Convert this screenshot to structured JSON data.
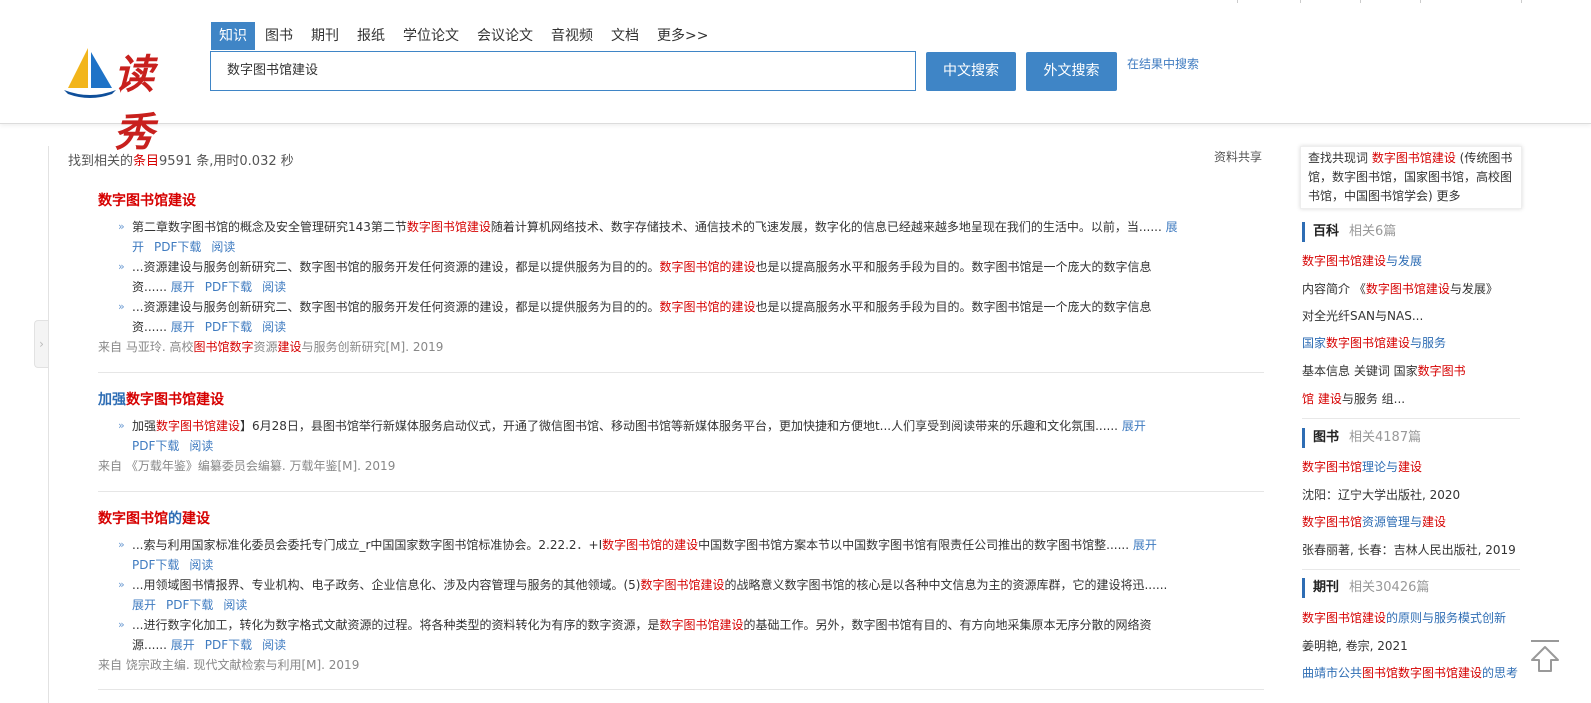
{
  "brand": {
    "logo_text": "读秀"
  },
  "tabs": [
    {
      "label": "知识",
      "active": true
    },
    {
      "label": "图书"
    },
    {
      "label": "期刊"
    },
    {
      "label": "报纸"
    },
    {
      "label": "学位论文"
    },
    {
      "label": "会议论文"
    },
    {
      "label": "音视频"
    },
    {
      "label": "文档"
    },
    {
      "label": "更多>>"
    }
  ],
  "search": {
    "value": "数字图书馆建设",
    "cn_button": "中文搜索",
    "foreign_button": "外文搜索",
    "in_result": "在结果中搜索"
  },
  "summary": {
    "prefix": "找到相关的",
    "entries_word": "条目",
    "count": "9591",
    "suffix": " 条,用时0.032 秒",
    "share": "资料共享"
  },
  "results": [
    {
      "title_parts": [
        {
          "t": "数字图书馆建设",
          "c": "red"
        }
      ],
      "snippets": [
        {
          "parts": [
            {
              "t": "第二章数字图书馆的概念及安全管理研究143第二节"
            },
            {
              "t": "数字图书馆建设",
              "hl": true
            },
            {
              "t": "随着计算机网络技术、数字存储技术、通信技术的飞速发展，数字化的信息已经越来越多地呈现在我们的生活中。以前，当......"
            }
          ],
          "actions": [
            "展开",
            "PDF下载",
            "阅读"
          ]
        },
        {
          "parts": [
            {
              "t": "...资源建设与服务创新研究二、数字图书馆的服务开发任何资源的建设，都是以提供服务为目的的。"
            },
            {
              "t": "数字图书馆的建设",
              "hl": true
            },
            {
              "t": "也是以提高服务水平和服务手段为目的。数字图书馆是一个庞大的数字信息资......"
            }
          ],
          "actions": [
            "展开",
            "PDF下载",
            "阅读"
          ]
        },
        {
          "parts": [
            {
              "t": "...资源建设与服务创新研究二、数字图书馆的服务开发任何资源的建设，都是以提供服务为目的的。"
            },
            {
              "t": "数字图书馆的建设",
              "hl": true
            },
            {
              "t": "也是以提高服务水平和服务手段为目的。数字图书馆是一个庞大的数字信息资......"
            }
          ],
          "actions": [
            "展开",
            "PDF下载",
            "阅读"
          ]
        }
      ],
      "source_parts": [
        {
          "t": "来自 马亚玲. 高校"
        },
        {
          "t": "图书馆数字",
          "hl": true
        },
        {
          "t": "资源"
        },
        {
          "t": "建设",
          "hl": true
        },
        {
          "t": "与服务创新研究[M]. 2019"
        }
      ]
    },
    {
      "title_parts": [
        {
          "t": "加强",
          "c": "blue"
        },
        {
          "t": "数字图书馆建设",
          "c": "red"
        }
      ],
      "snippets": [
        {
          "parts": [
            {
              "t": "加强"
            },
            {
              "t": "数字图书馆建设",
              "hl": true
            },
            {
              "t": "】6月28日，县图书馆举行新媒体服务启动仪式，开通了微信图书馆、移动图书馆等新媒体服务平台，更加快捷和方便地t...人们享受到阅读带来的乐趣和文化氛围......"
            }
          ],
          "actions": [
            "展开",
            "PDF下载",
            "阅读"
          ]
        }
      ],
      "source_parts": [
        {
          "t": "来自 《万载年鉴》编纂委员会编纂. 万载年鉴[M]. 2019"
        }
      ]
    },
    {
      "title_parts": [
        {
          "t": "数字图书馆",
          "c": "red"
        },
        {
          "t": "的",
          "c": "blue"
        },
        {
          "t": "建设",
          "c": "red"
        }
      ],
      "snippets": [
        {
          "parts": [
            {
              "t": "...索与利用国家标准化委员会委托专门成立_r中国国家数字图书馆标准协会。2.22.2．+I"
            },
            {
              "t": "数字图书馆的建设",
              "hl": true
            },
            {
              "t": "中国数字图书馆方案本节以中国数字图书馆有限责任公司推出的数字图书馆整......"
            }
          ],
          "actions": [
            "展开",
            "PDF下载",
            "阅读"
          ]
        },
        {
          "parts": [
            {
              "t": "...用领域图书情报界、专业机构、电子政务、企业信息化、涉及内容管理与服务的其他领域。(5)"
            },
            {
              "t": "数字图书馆建设",
              "hl": true
            },
            {
              "t": "的战略意义数字图书馆的核心是以各种中文信息为主的资源库群，它的建设将迅......"
            }
          ],
          "actions": [
            "展开",
            "PDF下载",
            "阅读"
          ]
        },
        {
          "parts": [
            {
              "t": "...进行数字化加工，转化为数字格式文献资源的过程。将各种类型的资料转化为有序的数字资源，是"
            },
            {
              "t": "数字图书馆建设",
              "hl": true
            },
            {
              "t": "的基础工作。另外，数字图书馆有目的、有方向地采集原本无序分散的网络资源......"
            }
          ],
          "actions": [
            "展开",
            "PDF下载",
            "阅读"
          ]
        }
      ],
      "source_parts": [
        {
          "t": "来自 饶宗政主编. 现代文献检索与利用[M]. 2019"
        }
      ]
    }
  ],
  "sidebar": {
    "cooc": {
      "prefix": "查找共现词 ",
      "term": "数字图书馆建设",
      "rest": " (传统图书馆，数字图书馆，国家图书馆，高校图书馆，中国图书馆学会)  更多"
    },
    "baike": {
      "title": "百科",
      "count": "相关6篇",
      "line1": [
        {
          "t": "数字图书馆建设",
          "c": "red"
        },
        {
          "t": "与发展",
          "c": "blue"
        }
      ],
      "line2": [
        {
          "t": "内容简介          《"
        },
        {
          "t": "数字图书馆建设",
          "c": "red"
        },
        {
          "t": "与发展》"
        }
      ],
      "line3": [
        {
          "t": "对全光纤SAN与NAS..."
        }
      ],
      "line4": [
        {
          "t": "国家",
          "c": "blue"
        },
        {
          "t": "数字图书馆建设",
          "c": "red"
        },
        {
          "t": "与服务",
          "c": "blue"
        }
      ],
      "line5": [
        {
          "t": "基本信息        关键词        国家"
        },
        {
          "t": "数字图书",
          "c": "red"
        }
      ],
      "line6": [
        {
          "t": "馆 建设",
          "c": "red"
        },
        {
          "t": "与服务        组..."
        }
      ]
    },
    "books": {
      "title": "图书",
      "count": "相关4187篇",
      "items": [
        {
          "title_parts": [
            {
              "t": "数字图书馆",
              "c": "red"
            },
            {
              "t": "理论与",
              "c": "blue"
            },
            {
              "t": "建设",
              "c": "red"
            }
          ],
          "meta": "沈阳：辽宁大学出版社, 2020"
        },
        {
          "title_parts": [
            {
              "t": "数字图书馆",
              "c": "red"
            },
            {
              "t": "资源管理与",
              "c": "blue"
            },
            {
              "t": "建设",
              "c": "red"
            }
          ],
          "meta": "张春丽著, 长春：吉林人民出版社, 2019"
        }
      ]
    },
    "journals": {
      "title": "期刊",
      "count": "相关30426篇",
      "items": [
        {
          "title_parts": [
            {
              "t": "数字图书馆建设",
              "c": "red"
            },
            {
              "t": "的原则与服务模式创新",
              "c": "blue"
            }
          ],
          "meta": "姜明艳, 卷宗, 2021"
        },
        {
          "title_parts": [
            {
              "t": "曲靖市公共",
              "c": "blue"
            },
            {
              "t": "图书馆数字图书馆建设",
              "c": "red"
            },
            {
              "t": "的思考",
              "c": "blue"
            }
          ],
          "meta": ""
        }
      ]
    }
  }
}
